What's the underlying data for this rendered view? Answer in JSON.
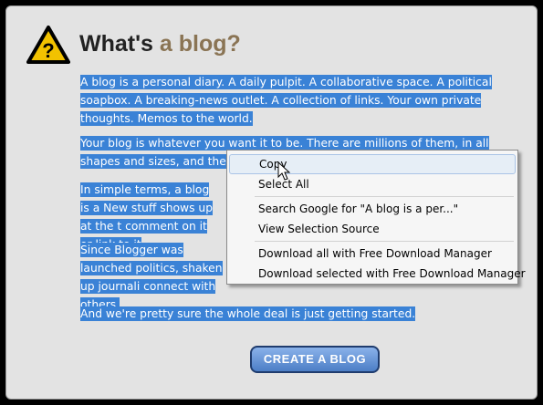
{
  "header": {
    "title_main": "What's",
    "title_accent": "a blog?"
  },
  "paragraphs": [
    "A blog is a personal diary. A daily pulpit. A collaborative space. A political soapbox. A breaking-news outlet. A collection of links. Your own private thoughts. Memos to the world.",
    "Your blog is whatever you want it to be. There are millions of them, in all shapes and sizes, and there are no",
    "In simple terms, a blog is a New stuff shows up at the t comment on it or link to it",
    "Since Blogger was launched politics, shaken up journali connect with others.",
    "And we're pretty sure the whole deal is just getting started."
  ],
  "context_menu": {
    "items": [
      "Copy",
      "Select All",
      "Search Google for \"A blog is a per...\"",
      "View Selection Source",
      "Download all with Free Download Manager",
      "Download selected with Free Download Manager"
    ]
  },
  "cta": {
    "label": "CREATE A BLOG"
  },
  "colors": {
    "selection": "#3a82d6",
    "accent": "#8a7454",
    "button": "#4c7ec6"
  },
  "icons": {
    "header": "question-warning-icon",
    "cursor": "mouse-pointer-icon"
  }
}
